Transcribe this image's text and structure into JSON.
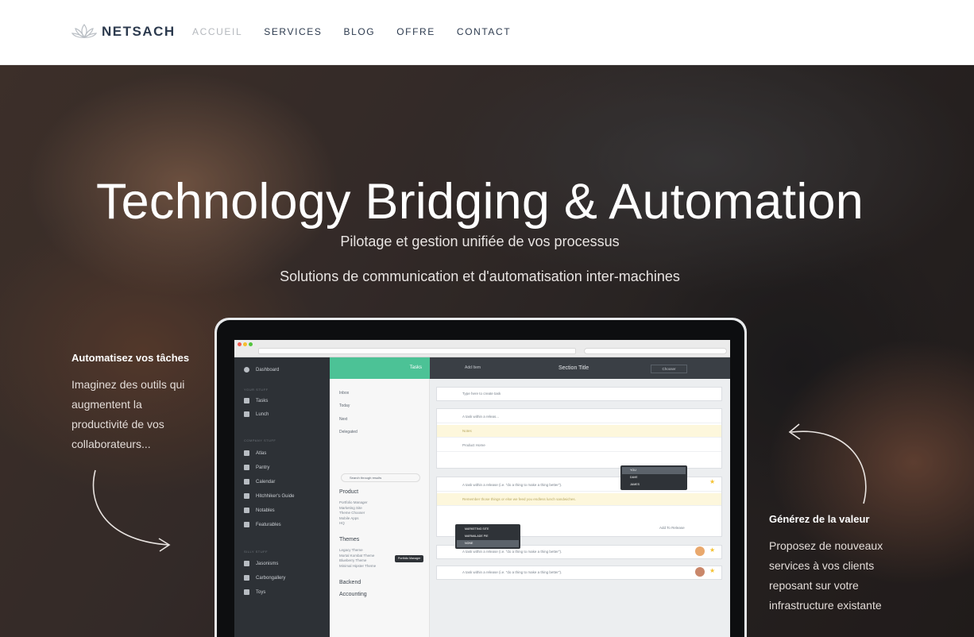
{
  "nav": {
    "brand": "NETSACH",
    "items": [
      {
        "label": "ACCUEIL",
        "active": true
      },
      {
        "label": "SERVICES",
        "active": false
      },
      {
        "label": "BLOG",
        "active": false
      },
      {
        "label": "OFFRE",
        "active": false
      },
      {
        "label": "CONTACT",
        "active": false
      }
    ]
  },
  "hero": {
    "title": "Technology Bridging & Automation",
    "subtitle1": "Pilotage et gestion unifiée de vos processus",
    "subtitle2": "Solutions de communication et d'automatisation inter-machines"
  },
  "features": {
    "left": {
      "heading": "Automatisez vos tâches",
      "text": "Imaginez des outils qui augmentent la productivité de vos collaborateurs..."
    },
    "right": {
      "heading": "Générez de la valeur",
      "text": "Proposez de nouveaux services à vos clients reposant sur votre infrastructure existante"
    }
  },
  "mockup": {
    "sidebar": {
      "top": "Dashboard",
      "section1": "YOUR STUFF",
      "items1": [
        "Tasks",
        "Lunch"
      ],
      "section2": "COMPANY STUFF",
      "items2": [
        "Atlas",
        "Pantry",
        "Calendar",
        "Hitchhiker's Guide",
        "Notables",
        "Featurables"
      ],
      "section3": "SILLY STUFF",
      "items3": [
        "Jasonisms",
        "Carbongallery",
        "Toys"
      ]
    },
    "middle": {
      "header": "Tasks",
      "items": [
        "Inbox",
        "Today",
        "Next",
        "Delegated"
      ],
      "search": "Search through results",
      "categories": [
        "Product",
        "Themes",
        "Backend",
        "Accounting"
      ],
      "product_subs": [
        "Portfolio Manager",
        "Marketing Site",
        "Theme Chooser",
        "Mobile Apps",
        "HQ"
      ],
      "theme_subs": [
        "Legacy Theme",
        "Mortal Kombat Theme",
        "Blueberry Theme",
        "Minimal Hipster Theme"
      ],
      "tooltip": "Portfolio Manager"
    },
    "main": {
      "title": "Section Title",
      "add": "Add Item",
      "chooser": "Chooser",
      "placeholder": "Type here to create task",
      "task1": "A task within a releas...",
      "notes": "Notes",
      "product_home": "Product Home",
      "task2": "A task within a release (i.e. \"do a thing to make a thing better\").",
      "remember": "Remember those things or else we feed you endless lunch sandwiches.",
      "task3": "A task within a release (i.e. \"do a thing to make a thing better\").",
      "task4": "A task within a release (i.e. \"do a thing to make a thing better\").",
      "add_release": "Add To Release",
      "delete": "Delete Task",
      "people": [
        "YOU",
        "DAVE",
        "JAMES"
      ],
      "projects": [
        "MARKETING SITE",
        "MARMALADE PIE",
        "NONE"
      ]
    }
  }
}
